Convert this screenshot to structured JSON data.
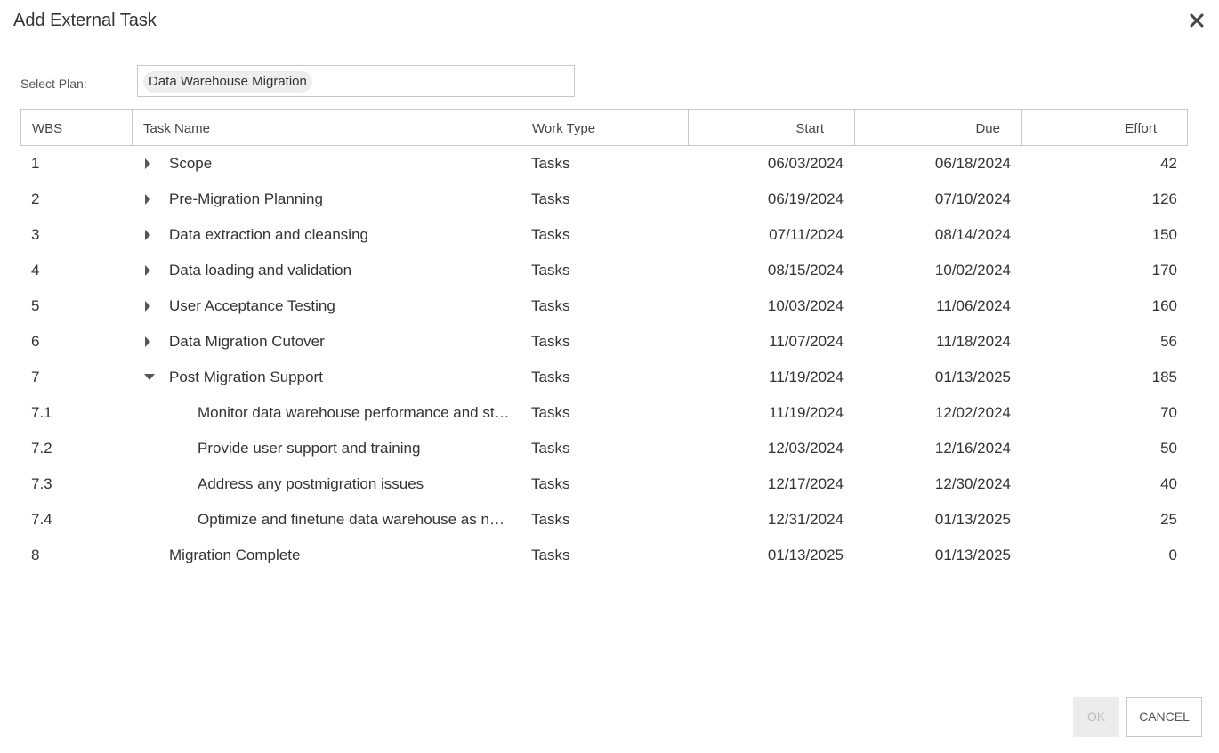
{
  "dialog": {
    "title": "Add External Task",
    "close_icon": "close-icon"
  },
  "plan": {
    "label": "Select Plan:",
    "selected": "Data Warehouse Migration"
  },
  "grid": {
    "columns": {
      "wbs": "WBS",
      "name": "Task Name",
      "type": "Work Type",
      "start": "Start",
      "due": "Due",
      "effort": "Effort"
    },
    "rows": [
      {
        "wbs": "1",
        "name": "Scope",
        "type": "Tasks",
        "start": "06/03/2024",
        "due": "06/18/2024",
        "effort": "42",
        "toggle": "collapsed",
        "level": 1
      },
      {
        "wbs": "2",
        "name": "Pre-Migration Planning",
        "type": "Tasks",
        "start": "06/19/2024",
        "due": "07/10/2024",
        "effort": "126",
        "toggle": "collapsed",
        "level": 1
      },
      {
        "wbs": "3",
        "name": "Data extraction and cleansing",
        "type": "Tasks",
        "start": "07/11/2024",
        "due": "08/14/2024",
        "effort": "150",
        "toggle": "collapsed",
        "level": 1
      },
      {
        "wbs": "4",
        "name": "Data loading and validation",
        "type": "Tasks",
        "start": "08/15/2024",
        "due": "10/02/2024",
        "effort": "170",
        "toggle": "collapsed",
        "level": 1
      },
      {
        "wbs": "5",
        "name": "User Acceptance Testing",
        "type": "Tasks",
        "start": "10/03/2024",
        "due": "11/06/2024",
        "effort": "160",
        "toggle": "collapsed",
        "level": 1
      },
      {
        "wbs": "6",
        "name": "Data Migration Cutover",
        "type": "Tasks",
        "start": "11/07/2024",
        "due": "11/18/2024",
        "effort": "56",
        "toggle": "collapsed",
        "level": 1
      },
      {
        "wbs": "7",
        "name": "Post Migration Support",
        "type": "Tasks",
        "start": "11/19/2024",
        "due": "01/13/2025",
        "effort": "185",
        "toggle": "expanded",
        "level": 1
      },
      {
        "wbs": "7.1",
        "name": "Monitor data warehouse performance and stability",
        "type": "Tasks",
        "start": "11/19/2024",
        "due": "12/02/2024",
        "effort": "70",
        "toggle": "none",
        "level": 2
      },
      {
        "wbs": "7.2",
        "name": "Provide user support and training",
        "type": "Tasks",
        "start": "12/03/2024",
        "due": "12/16/2024",
        "effort": "50",
        "toggle": "none",
        "level": 2
      },
      {
        "wbs": "7.3",
        "name": "Address any postmigration issues",
        "type": "Tasks",
        "start": "12/17/2024",
        "due": "12/30/2024",
        "effort": "40",
        "toggle": "none",
        "level": 2
      },
      {
        "wbs": "7.4",
        "name": "Optimize and finetune data warehouse as needed",
        "type": "Tasks",
        "start": "12/31/2024",
        "due": "01/13/2025",
        "effort": "25",
        "toggle": "none",
        "level": 2
      },
      {
        "wbs": "8",
        "name": "Migration Complete",
        "type": "Tasks",
        "start": "01/13/2025",
        "due": "01/13/2025",
        "effort": "0",
        "toggle": "none",
        "level": 1
      }
    ]
  },
  "buttons": {
    "ok": "OK",
    "cancel": "CANCEL"
  }
}
